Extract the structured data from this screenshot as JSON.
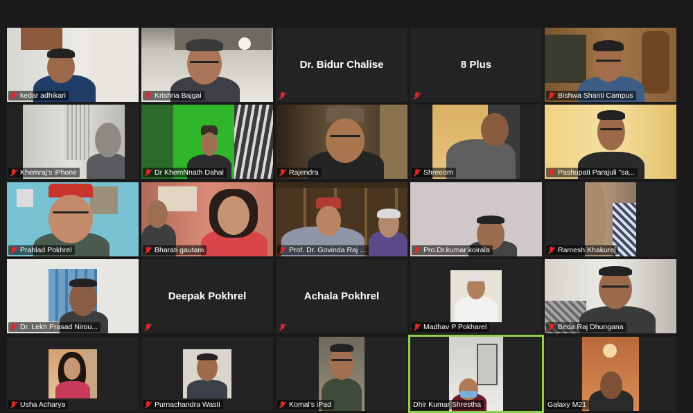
{
  "meeting": {
    "participants": [
      {
        "name": "kedar adhikari",
        "muted": true,
        "video": true
      },
      {
        "name": "Krishna Bajgai",
        "muted": true,
        "video": true
      },
      {
        "name": "Dr. Bidur Chalise",
        "muted": true,
        "video": false
      },
      {
        "name": "8 Plus",
        "muted": true,
        "video": false
      },
      {
        "name": "Bishwa Shanti Campus",
        "muted": true,
        "video": true
      },
      {
        "name": "Khemraj's iPhone",
        "muted": true,
        "video": true
      },
      {
        "name": "Dr KhemNnath Dahal",
        "muted": true,
        "video": true
      },
      {
        "name": "Rajendra",
        "muted": true,
        "video": true
      },
      {
        "name": "Shreeom",
        "muted": true,
        "video": true
      },
      {
        "name": "Pashupati Parajuli \"sa...",
        "muted": true,
        "video": true
      },
      {
        "name": "Prahlad Pokhrel",
        "muted": true,
        "video": true
      },
      {
        "name": "Bharati gautam",
        "muted": true,
        "video": true
      },
      {
        "name": "Prof. Dr. Govinda Raj ...",
        "muted": true,
        "video": true
      },
      {
        "name": "Pro.Dr.kumar  koirala",
        "muted": true,
        "video": true
      },
      {
        "name": "Ramesh Khakurel",
        "muted": true,
        "video": true
      },
      {
        "name": "Dr. Lekh Prasad Nirou...",
        "muted": true,
        "video": true
      },
      {
        "name": "Deepak Pokhrel",
        "muted": true,
        "video": false
      },
      {
        "name": "Achala Pokhrel",
        "muted": true,
        "video": false
      },
      {
        "name": "Madhav P Pokharel",
        "muted": true,
        "video": true
      },
      {
        "name": "Beda Raj Dhungana",
        "muted": true,
        "video": true
      },
      {
        "name": "Usha Acharya",
        "muted": true,
        "video": true
      },
      {
        "name": "Purnachandra Wasti",
        "muted": true,
        "video": true
      },
      {
        "name": "Komal's iPad",
        "muted": true,
        "video": true
      },
      {
        "name": "Dhir Kumar Shrestha",
        "muted": false,
        "video": true,
        "active_speaker": true
      },
      {
        "name": "Galaxy M21",
        "muted": false,
        "video": true
      }
    ]
  },
  "colors": {
    "background": "#1a1a1a",
    "tile": "#232323",
    "active_border": "#8fd14f",
    "muted_icon": "#e02828",
    "label_text": "#ffffff"
  },
  "icons": {
    "muted": "microphone-muted-icon"
  }
}
